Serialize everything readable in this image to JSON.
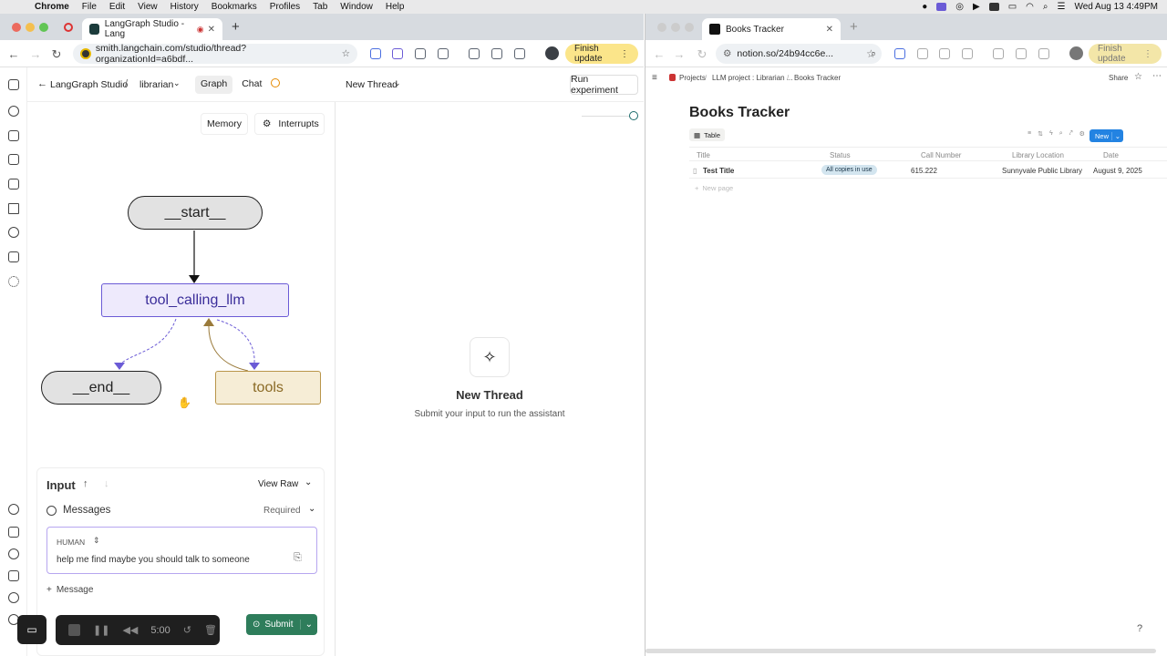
{
  "menubar": {
    "app": "Chrome",
    "items": [
      "File",
      "Edit",
      "View",
      "History",
      "Bookmarks",
      "Profiles",
      "Tab",
      "Window",
      "Help"
    ],
    "clock": "Wed Aug 13  4:49PM"
  },
  "left_browser": {
    "tab_title": "LangGraph Studio - Lang",
    "url": "smith.langchain.com/studio/thread?organizationId=a6bdf...",
    "finish_update": "Finish update"
  },
  "right_browser": {
    "tab_title": "Books Tracker",
    "url": "notion.so/24b94cc6e...",
    "finish_update": "Finish update"
  },
  "studio": {
    "back_label": "LangGraph Studio",
    "separator": "/",
    "graph_name": "librarian",
    "tabs": [
      "Graph",
      "Chat"
    ],
    "thread_label": "New Thread",
    "run_experiment": "Run experiment",
    "memory_button": "Memory",
    "interrupts_button": "Interrupts",
    "nodes": {
      "start": "__start__",
      "llm": "tool_calling_llm",
      "end": "__end__",
      "tools": "tools"
    },
    "empty_title": "New Thread",
    "empty_sub": "Submit your input to run the assistant",
    "input": {
      "title": "Input",
      "view_raw": "View Raw",
      "messages_label": "Messages",
      "required": "Required",
      "role": "HUMAN",
      "message_text": "help me find maybe you should talk to someone",
      "add_message": "Message",
      "submit": "Submit"
    }
  },
  "recorder": {
    "time": "5:00"
  },
  "notion": {
    "breadcrumb": [
      "Projects",
      "LLM project : Librarian ...",
      "Books Tracker"
    ],
    "share": "Share",
    "page_title": "Books Tracker",
    "view_tab": "Table",
    "new_button": "New",
    "columns": [
      "Title",
      "Status",
      "Call Number",
      "Library Location",
      "Date"
    ],
    "rows": [
      {
        "title": "Test Title",
        "status": "All copies in use",
        "call_number": "615.222",
        "location": "Sunnyvale Public Library",
        "date": "August 9, 2025"
      }
    ],
    "new_page": "New page"
  }
}
